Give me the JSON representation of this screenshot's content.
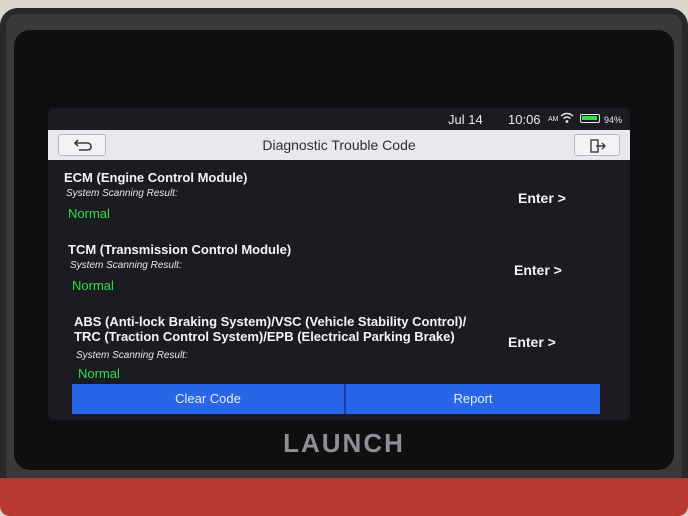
{
  "status": {
    "date": "Jul 14",
    "time": "10:06",
    "ampm": "AM",
    "battery": "94%"
  },
  "header": {
    "title": "Diagnostic Trouble Code"
  },
  "modules": [
    {
      "name": "ECM (Engine Control Module)",
      "scan_label": "System Scanning Result:",
      "result": "Normal",
      "enter": "Enter >"
    },
    {
      "name": "TCM (Transmission Control Module)",
      "scan_label": "System Scanning Result:",
      "result": "Normal",
      "enter": "Enter >"
    },
    {
      "name": "ABS (Anti-lock Braking System)/VSC (Vehicle Stability Control)/ TRC (Traction Control System)/EPB (Electrical Parking Brake)",
      "scan_label": "System Scanning Result:",
      "result": "Normal",
      "enter": "Enter >"
    }
  ],
  "footer": {
    "clear_label": "Clear Code",
    "report_label": "Report"
  },
  "device": {
    "brand": "LAUNCH"
  },
  "colors": {
    "accent": "#2766e6",
    "ok": "#36d948"
  }
}
